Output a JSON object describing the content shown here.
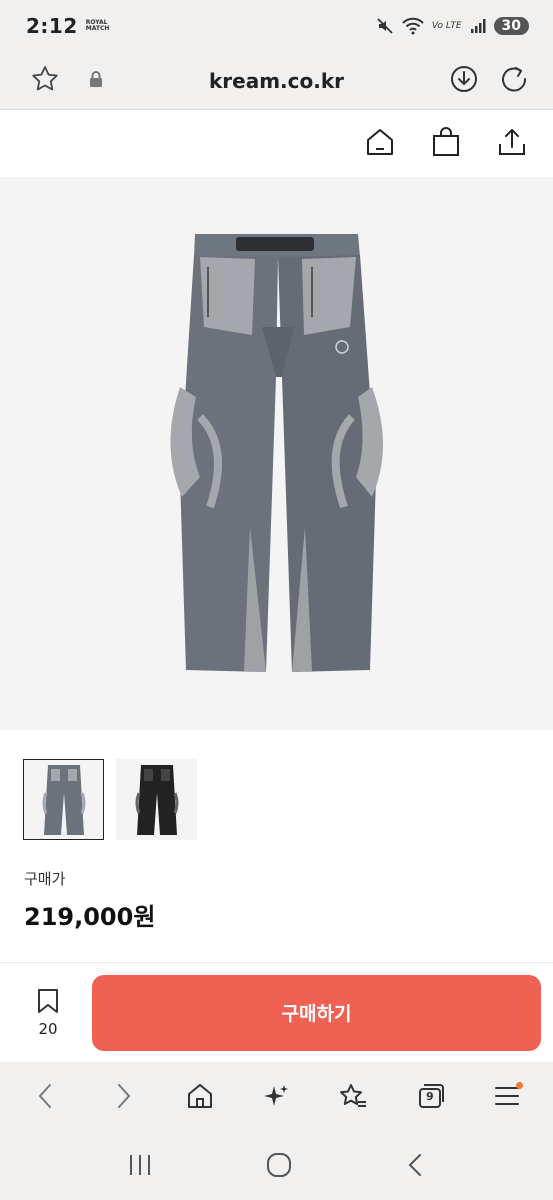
{
  "status_bar": {
    "time": "2:12",
    "logo_text": "ROYAL MATCH",
    "volte": "Vo LTE",
    "battery": "30"
  },
  "address_bar": {
    "url": "kream.co.kr",
    "icons": [
      "star-icon",
      "lock-icon",
      "download-icon",
      "reload-icon"
    ]
  },
  "site_header": {
    "icons": [
      "home-icon",
      "shopping-bag-icon",
      "share-icon"
    ]
  },
  "product": {
    "image": "gray-cargo-pants",
    "thumbnails": [
      {
        "name": "gray-pants",
        "selected": true
      },
      {
        "name": "black-pants",
        "selected": false
      }
    ],
    "price_label": "구매가",
    "price": "219,000원"
  },
  "bottom_action": {
    "bookmark_count": "20",
    "buy_label": "구매하기",
    "buy_color": "#ef6253"
  },
  "browser_toolbar": {
    "tabs_count": "9",
    "icons": [
      "back-icon",
      "forward-icon",
      "home-icon",
      "sparkle-icon",
      "bookmarks-icon",
      "tabs-icon",
      "menu-icon"
    ]
  },
  "nav_bar": {
    "icons": [
      "recents-icon",
      "home-icon",
      "back-icon"
    ]
  }
}
